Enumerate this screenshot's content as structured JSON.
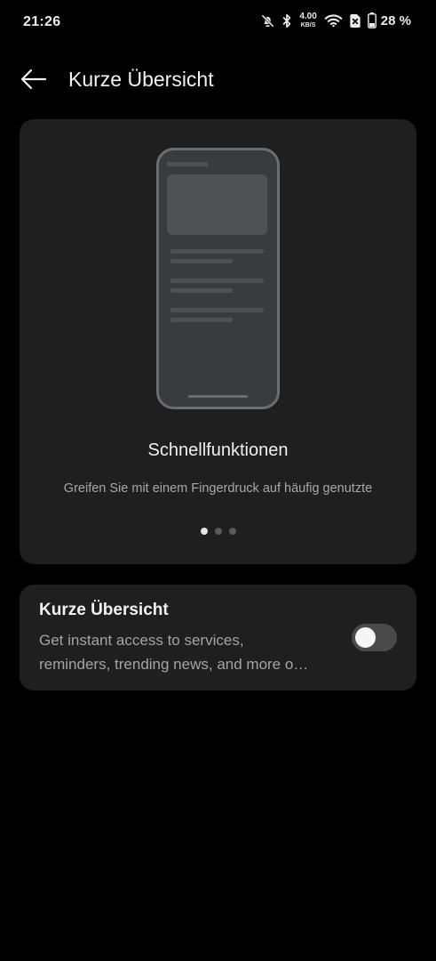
{
  "status_bar": {
    "time": "21:26",
    "net_speed_value": "4.00",
    "net_speed_unit": "KB/S",
    "battery_percent": "28 %",
    "icons": [
      "bell-muted-icon",
      "bluetooth-icon",
      "wifi-icon",
      "sim-off-icon",
      "battery-icon"
    ]
  },
  "header": {
    "title": "Kurze Übersicht",
    "back_icon": "arrow-left-icon"
  },
  "preview": {
    "illustration": "phone-illustration",
    "title": "Schnellfunktionen",
    "description": "Greifen Sie mit einem Fingerdruck auf häufig genutzte",
    "pager": {
      "count": 3,
      "active_index": 0
    }
  },
  "setting": {
    "title": "Kurze Übersicht",
    "description_line1": "Get instant access to services,",
    "description_line2": "reminders, trending news, and more o…",
    "toggle_on": false
  }
}
